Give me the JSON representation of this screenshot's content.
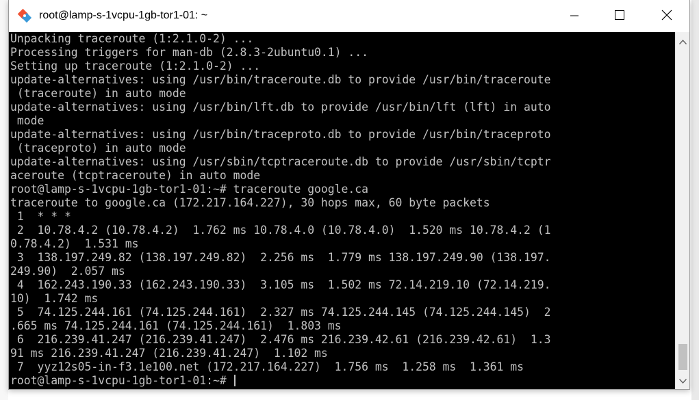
{
  "window": {
    "title": "root@lamp-s-1vcpu-1gb-tor1-01: ~"
  },
  "terminal": {
    "lines": [
      "Unpacking traceroute (1:2.1.0-2) ...",
      "Processing triggers for man-db (2.8.3-2ubuntu0.1) ...",
      "Setting up traceroute (1:2.1.0-2) ...",
      "update-alternatives: using /usr/bin/traceroute.db to provide /usr/bin/traceroute",
      " (traceroute) in auto mode",
      "update-alternatives: using /usr/bin/lft.db to provide /usr/bin/lft (lft) in auto",
      " mode",
      "update-alternatives: using /usr/bin/traceproto.db to provide /usr/bin/traceproto",
      " (traceproto) in auto mode",
      "update-alternatives: using /usr/sbin/tcptraceroute.db to provide /usr/sbin/tcptr",
      "aceroute (tcptraceroute) in auto mode",
      "root@lamp-s-1vcpu-1gb-tor1-01:~# traceroute google.ca",
      "traceroute to google.ca (172.217.164.227), 30 hops max, 60 byte packets",
      " 1  * * *",
      " 2  10.78.4.2 (10.78.4.2)  1.762 ms 10.78.4.0 (10.78.4.0)  1.520 ms 10.78.4.2 (1",
      "0.78.4.2)  1.531 ms",
      " 3  138.197.249.82 (138.197.249.82)  2.256 ms  1.779 ms 138.197.249.90 (138.197.",
      "249.90)  2.057 ms",
      " 4  162.243.190.33 (162.243.190.33)  3.105 ms  1.502 ms 72.14.219.10 (72.14.219.",
      "10)  1.742 ms",
      " 5  74.125.244.161 (74.125.244.161)  2.327 ms 74.125.244.145 (74.125.244.145)  2",
      ".665 ms 74.125.244.161 (74.125.244.161)  1.803 ms",
      " 6  216.239.41.247 (216.239.41.247)  2.476 ms 216.239.42.61 (216.239.42.61)  1.3",
      "91 ms 216.239.41.247 (216.239.41.247)  1.102 ms",
      " 7  yyz12s05-in-f3.1e100.net (172.217.164.227)  1.756 ms  1.258 ms  1.361 ms"
    ],
    "prompt": "root@lamp-s-1vcpu-1gb-tor1-01:~# ",
    "text_color": "#c0c0c0",
    "background_color": "#000000"
  },
  "icons": {
    "app": "putty-app-icon",
    "minimize": "minimize-icon",
    "maximize": "maximize-icon",
    "close": "close-icon",
    "scroll_up": "scroll-up-arrow-icon",
    "scroll_down": "scroll-down-arrow-icon"
  }
}
